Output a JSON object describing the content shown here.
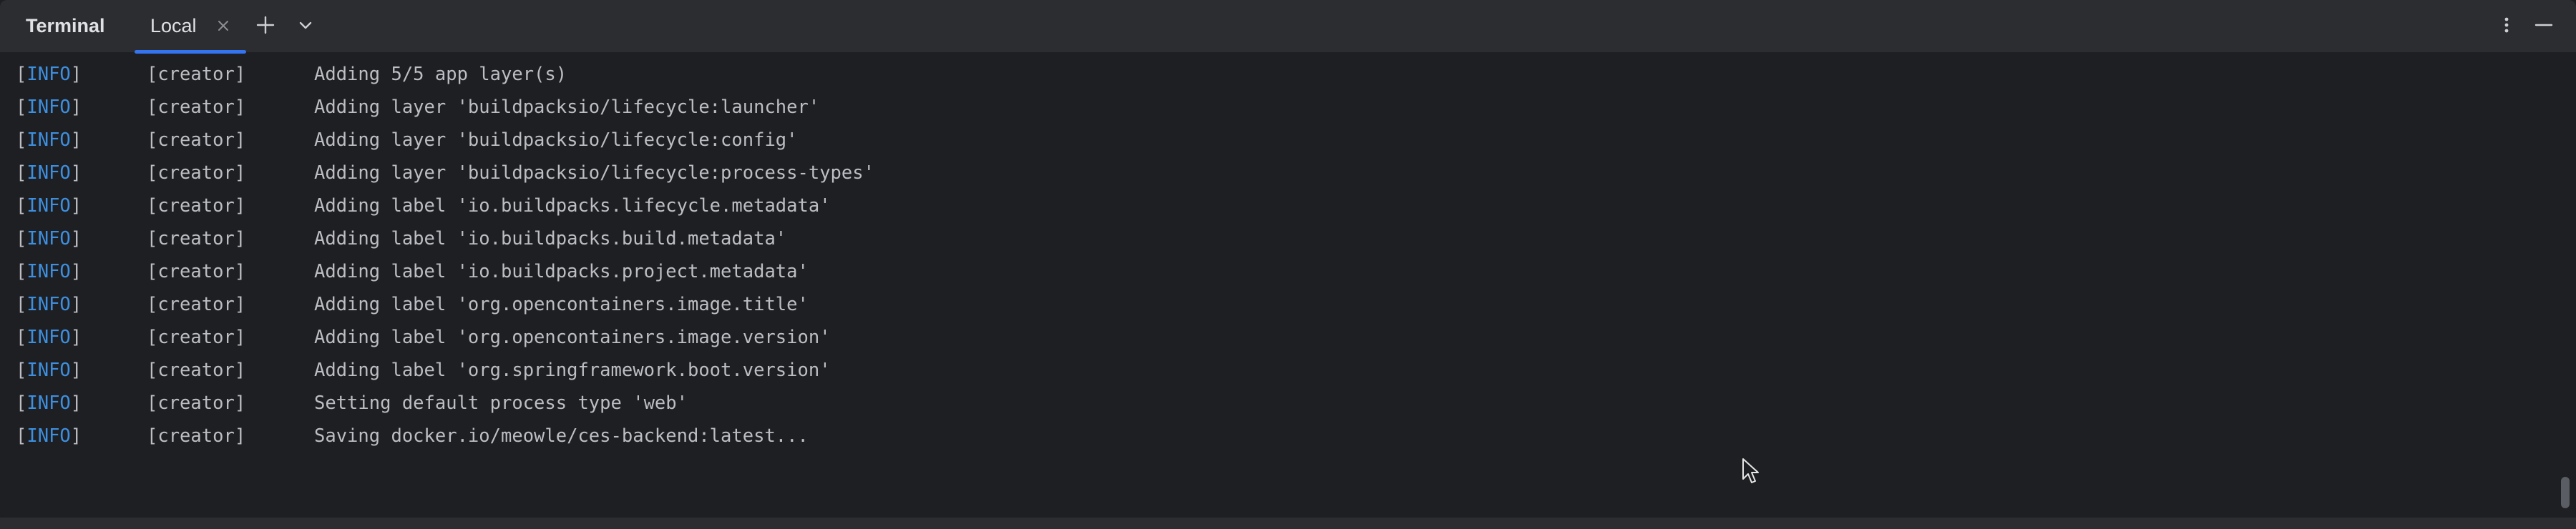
{
  "toolwindow": {
    "title": "Terminal",
    "tab_label": "Local",
    "icons": {
      "close": "close-icon",
      "add": "plus-icon",
      "dropdown": "chevron-down-icon",
      "more": "more-vertical-icon",
      "minimize": "minimize-icon"
    }
  },
  "terminal": {
    "lines": [
      {
        "level": "INFO",
        "source": "[creator]",
        "message": "Adding 5/5 app layer(s)"
      },
      {
        "level": "INFO",
        "source": "[creator]",
        "message": "Adding layer 'buildpacksio/lifecycle:launcher'"
      },
      {
        "level": "INFO",
        "source": "[creator]",
        "message": "Adding layer 'buildpacksio/lifecycle:config'"
      },
      {
        "level": "INFO",
        "source": "[creator]",
        "message": "Adding layer 'buildpacksio/lifecycle:process-types'"
      },
      {
        "level": "INFO",
        "source": "[creator]",
        "message": "Adding label 'io.buildpacks.lifecycle.metadata'"
      },
      {
        "level": "INFO",
        "source": "[creator]",
        "message": "Adding label 'io.buildpacks.build.metadata'"
      },
      {
        "level": "INFO",
        "source": "[creator]",
        "message": "Adding label 'io.buildpacks.project.metadata'"
      },
      {
        "level": "INFO",
        "source": "[creator]",
        "message": "Adding label 'org.opencontainers.image.title'"
      },
      {
        "level": "INFO",
        "source": "[creator]",
        "message": "Adding label 'org.opencontainers.image.version'"
      },
      {
        "level": "INFO",
        "source": "[creator]",
        "message": "Adding label 'org.springframework.boot.version'"
      },
      {
        "level": "INFO",
        "source": "[creator]",
        "message": "Setting default process type 'web'"
      },
      {
        "level": "INFO",
        "source": "[creator]",
        "message": "Saving docker.io/meowle/ces-backend:latest..."
      }
    ]
  },
  "colors": {
    "background": "#1e1f22",
    "toolbar": "#2b2d30",
    "text": "#bcbec4",
    "info_level": "#3d8fe0",
    "tab_accent": "#3574f0"
  }
}
